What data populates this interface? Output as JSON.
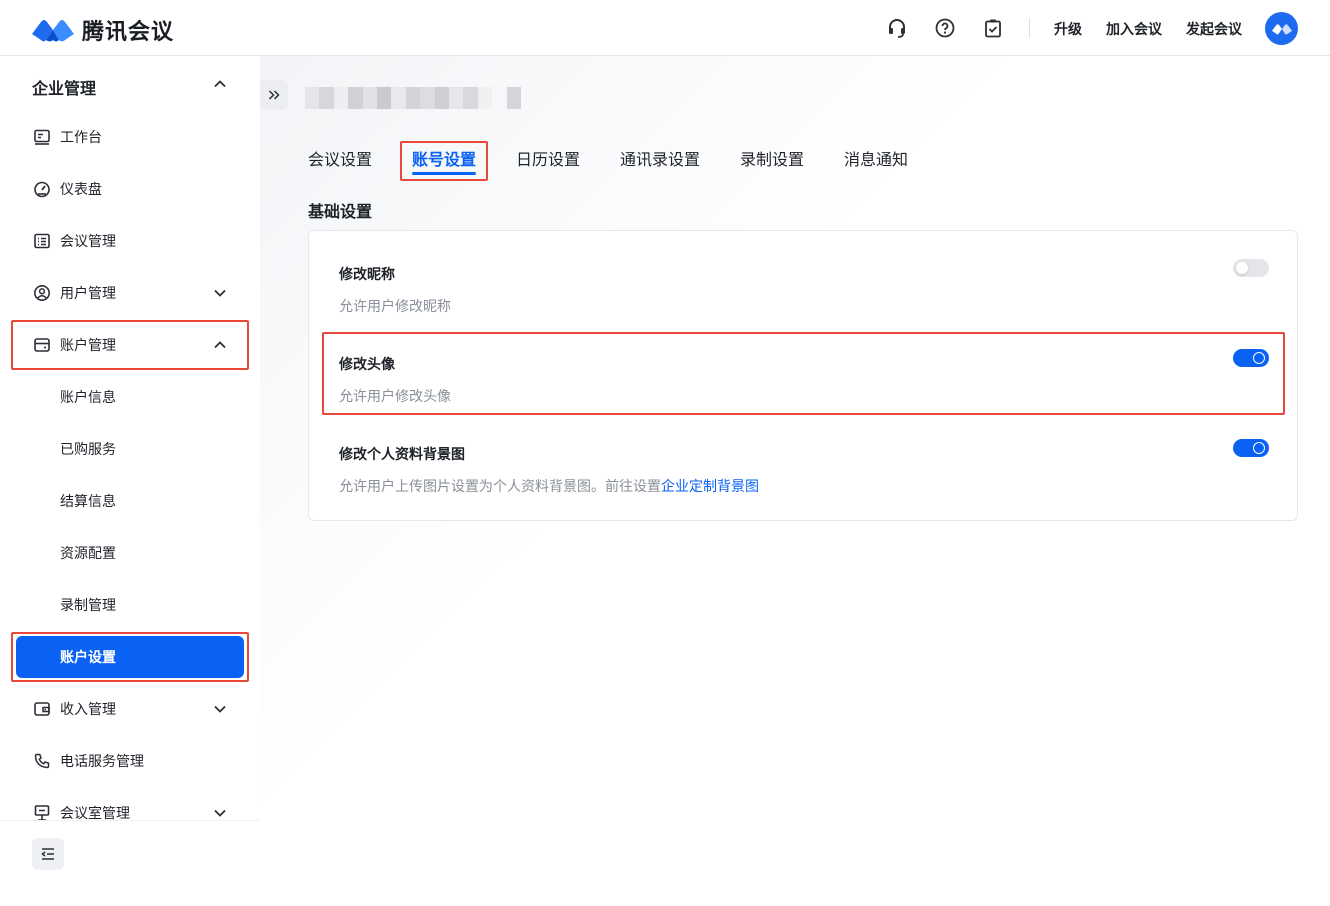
{
  "app": {
    "name": "腾讯会议"
  },
  "header": {
    "upgrade": "升级",
    "join_meeting": "加入会议",
    "start_meeting": "发起会议"
  },
  "sidebar": {
    "section_title": "企业管理",
    "items": [
      {
        "label": "工作台",
        "icon": "workbench-icon"
      },
      {
        "label": "仪表盘",
        "icon": "dashboard-icon"
      },
      {
        "label": "会议管理",
        "icon": "meeting-list-icon"
      },
      {
        "label": "用户管理",
        "icon": "user-icon",
        "expandable": true
      },
      {
        "label": "账户管理",
        "icon": "account-icon",
        "expanded": true
      }
    ],
    "sub_items": [
      {
        "label": "账户信息"
      },
      {
        "label": "已购服务"
      },
      {
        "label": "结算信息"
      },
      {
        "label": "资源配置"
      },
      {
        "label": "录制管理"
      },
      {
        "label": "账户设置",
        "active": true
      }
    ],
    "items_after": [
      {
        "label": "收入管理",
        "icon": "wallet-icon",
        "expandable": true
      },
      {
        "label": "电话服务管理",
        "icon": "phone-icon"
      },
      {
        "label": "会议室管理",
        "icon": "meeting-room-icon",
        "expandable": true
      }
    ]
  },
  "main": {
    "tabs": [
      {
        "label": "会议设置"
      },
      {
        "label": "账号设置",
        "active": true
      },
      {
        "label": "日历设置"
      },
      {
        "label": "通讯录设置"
      },
      {
        "label": "录制设置"
      },
      {
        "label": "消息通知"
      }
    ],
    "section_title": "基础设置",
    "settings": [
      {
        "title": "修改昵称",
        "desc": "允许用户修改昵称",
        "enabled": false
      },
      {
        "title": "修改头像",
        "desc": "允许用户修改头像",
        "enabled": true
      },
      {
        "title": "修改个人资料背景图",
        "desc": "允许用户上传图片设置为个人资料背景图。前往设置",
        "link": "企业定制背景图",
        "enabled": true
      }
    ]
  },
  "colors": {
    "accent": "#0a62f5",
    "highlight_box": "#e8483b"
  }
}
